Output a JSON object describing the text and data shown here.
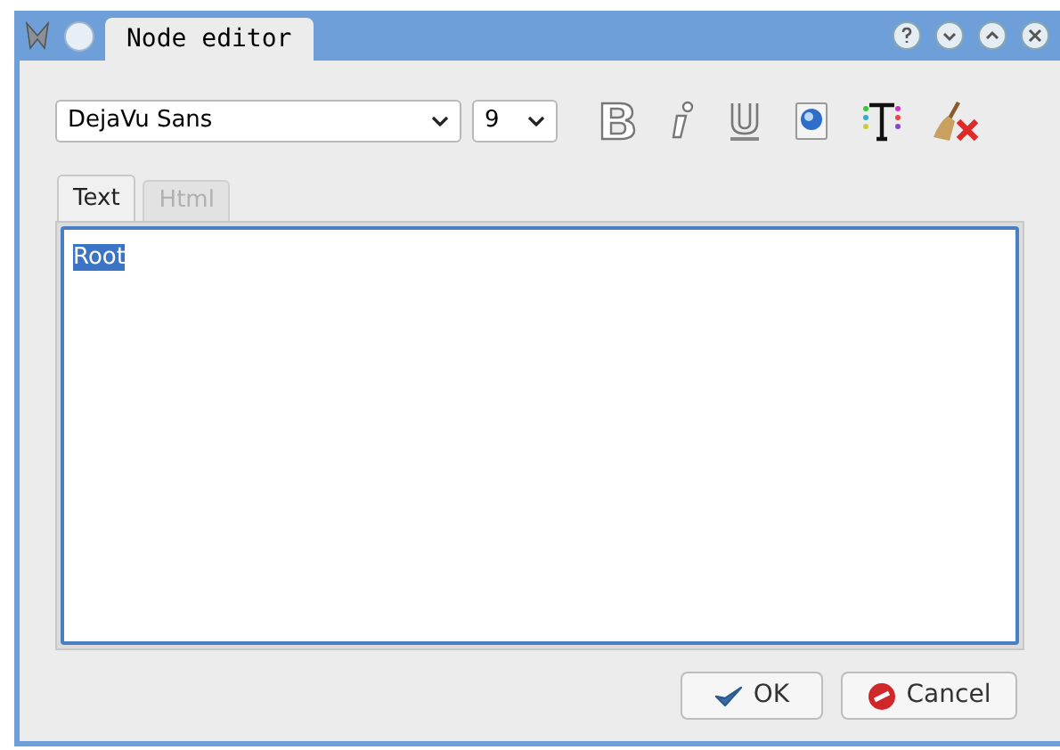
{
  "window": {
    "title": "Node editor"
  },
  "toolbar": {
    "font": "DejaVu Sans",
    "size": "9"
  },
  "tabs": [
    {
      "label": "Text",
      "selected": true,
      "disabled": false
    },
    {
      "label": "Html",
      "selected": false,
      "disabled": true
    }
  ],
  "editor": {
    "text": "Root",
    "text_selected": true
  },
  "buttons": [
    {
      "kind": "ok",
      "label": "OK"
    },
    {
      "kind": "cancel",
      "label": "Cancel"
    }
  ]
}
